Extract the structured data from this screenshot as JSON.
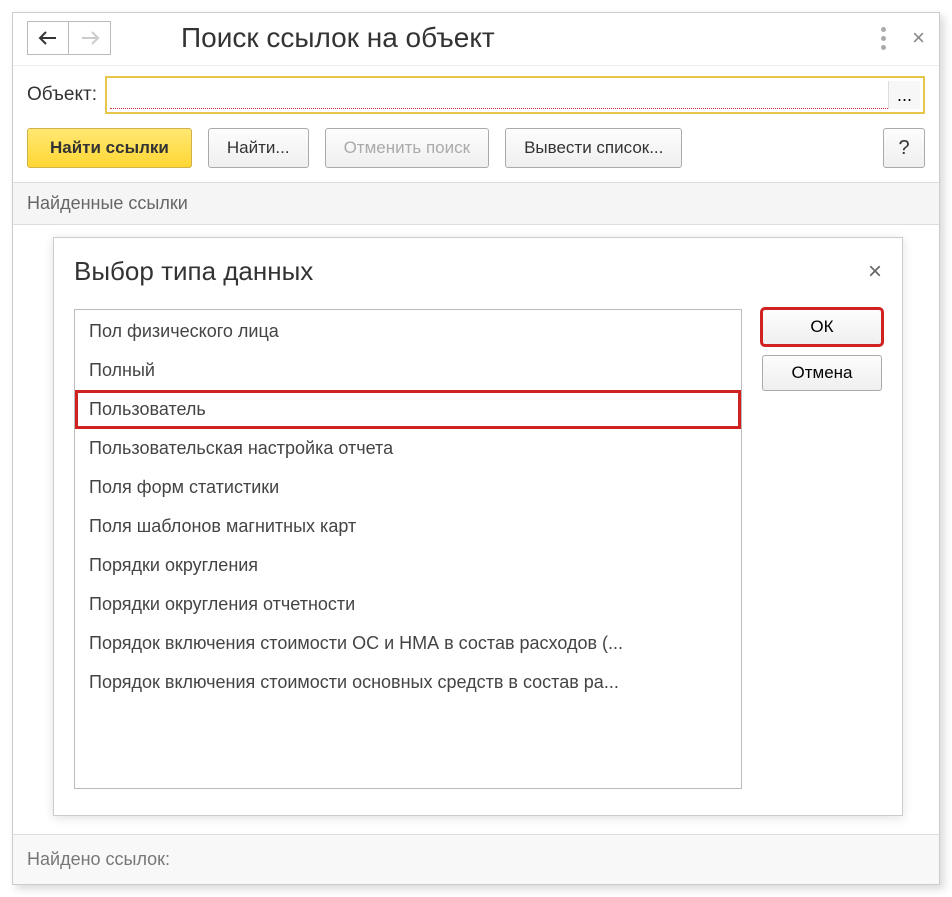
{
  "header": {
    "title": "Поиск ссылок на объект"
  },
  "object_row": {
    "label": "Объект:",
    "value": "",
    "ellipsis": "..."
  },
  "toolbar": {
    "find_links": "Найти ссылки",
    "find": "Найти...",
    "cancel_search": "Отменить поиск",
    "export_list": "Вывести список...",
    "help": "?"
  },
  "section": {
    "found_links": "Найденные ссылки"
  },
  "footer": {
    "found_count_label": "Найдено ссылок:"
  },
  "dialog": {
    "title": "Выбор типа данных",
    "ok": "ОК",
    "cancel": "Отмена",
    "items": [
      "Пол физического лица",
      "Полный",
      "Пользователь",
      "Пользовательская настройка отчета",
      "Поля форм статистики",
      "Поля шаблонов магнитных карт",
      "Порядки округления",
      "Порядки округления отчетности",
      "Порядок включения стоимости ОС и НМА в состав расходов (...",
      "Порядок включения стоимости основных средств в состав ра..."
    ],
    "highlighted_index": 2
  }
}
